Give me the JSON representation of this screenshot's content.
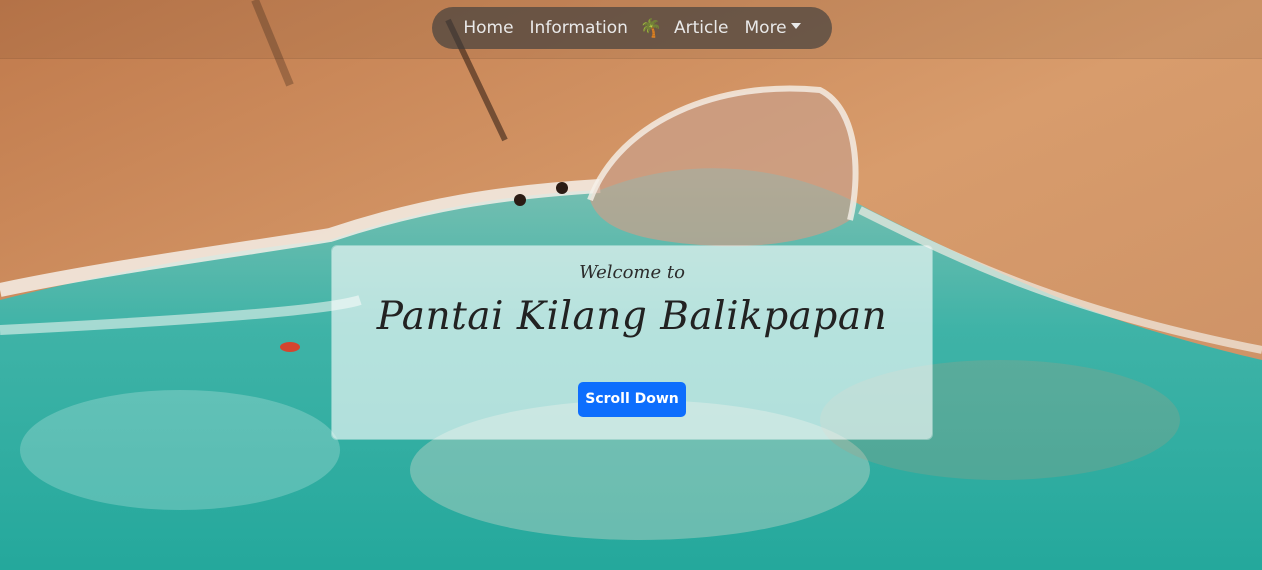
{
  "nav": {
    "home_label": "Home",
    "information_label": "Information",
    "brand_icon": "palm-tree-icon",
    "brand_glyph": "🌴",
    "article_label": "Article",
    "more_label": "More"
  },
  "hero": {
    "welcome_text": "Welcome to",
    "title": "Pantai Kilang Balikpapan",
    "scroll_button_label": "Scroll Down",
    "button_color": "#0d6efd",
    "sand_color": "#d59868",
    "sea_color": "#2aa99e"
  }
}
